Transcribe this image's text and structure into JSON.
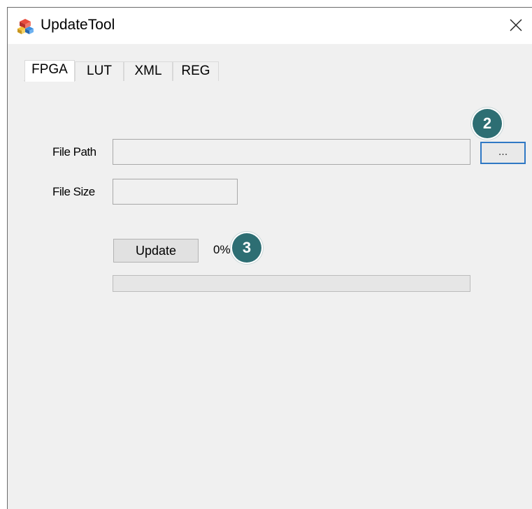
{
  "window": {
    "title": "UpdateTool",
    "close_glyph": "✕"
  },
  "tabs": [
    {
      "label": "FPGA",
      "active": true
    },
    {
      "label": "LUT",
      "active": false
    },
    {
      "label": "XML",
      "active": false
    },
    {
      "label": "REG",
      "active": false
    }
  ],
  "form": {
    "file_path_label": "File Path",
    "file_path_value": "",
    "browse_label": "...",
    "file_size_label": "File Size",
    "file_size_value": "",
    "update_label": "Update",
    "progress_text": "0%",
    "progress_fraction": 0
  },
  "annotations": {
    "marker_2": "2",
    "marker_3": "3"
  },
  "colors": {
    "marker": "#2d6e73",
    "focus_border": "#2f78c4",
    "window_bg": "#f0f0f0"
  }
}
